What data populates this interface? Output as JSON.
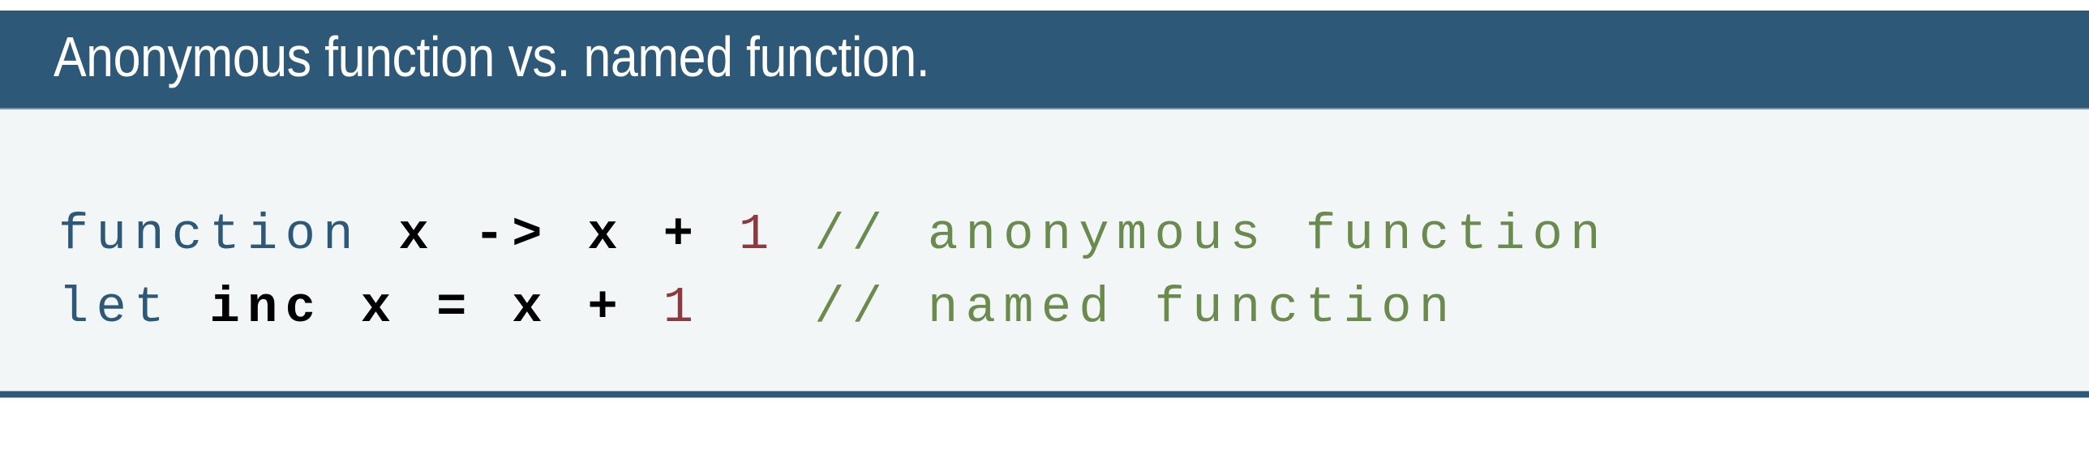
{
  "block": {
    "title": "Anonymous function vs. named function.",
    "colors": {
      "header_bg": "#2d5878",
      "body_bg": "#f2f6f7",
      "title_text": "#ffffff",
      "keyword": "#2d5878",
      "identifier": "#000000",
      "number": "#8c3a3e",
      "comment": "#6a8a4e"
    },
    "code": {
      "lines": [
        {
          "tokens": [
            {
              "type": "keyword",
              "text": "function"
            },
            {
              "type": "space",
              "text": " "
            },
            {
              "type": "ident",
              "text": "x"
            },
            {
              "type": "space",
              "text": " "
            },
            {
              "type": "op",
              "text": "->"
            },
            {
              "type": "space",
              "text": " "
            },
            {
              "type": "ident",
              "text": "x"
            },
            {
              "type": "space",
              "text": " "
            },
            {
              "type": "op",
              "text": "+"
            },
            {
              "type": "space",
              "text": " "
            },
            {
              "type": "number",
              "text": "1"
            },
            {
              "type": "space",
              "text": " "
            },
            {
              "type": "comment",
              "text": "// anonymous function"
            }
          ]
        },
        {
          "tokens": [
            {
              "type": "keyword",
              "text": "let"
            },
            {
              "type": "space",
              "text": " "
            },
            {
              "type": "ident",
              "text": "inc"
            },
            {
              "type": "space",
              "text": " "
            },
            {
              "type": "ident",
              "text": "x"
            },
            {
              "type": "space",
              "text": " "
            },
            {
              "type": "op",
              "text": "="
            },
            {
              "type": "space",
              "text": " "
            },
            {
              "type": "ident",
              "text": "x"
            },
            {
              "type": "space",
              "text": " "
            },
            {
              "type": "op",
              "text": "+"
            },
            {
              "type": "space",
              "text": " "
            },
            {
              "type": "number",
              "text": "1"
            },
            {
              "type": "space",
              "text": "   "
            },
            {
              "type": "comment",
              "text": "// named function"
            }
          ]
        }
      ]
    }
  }
}
